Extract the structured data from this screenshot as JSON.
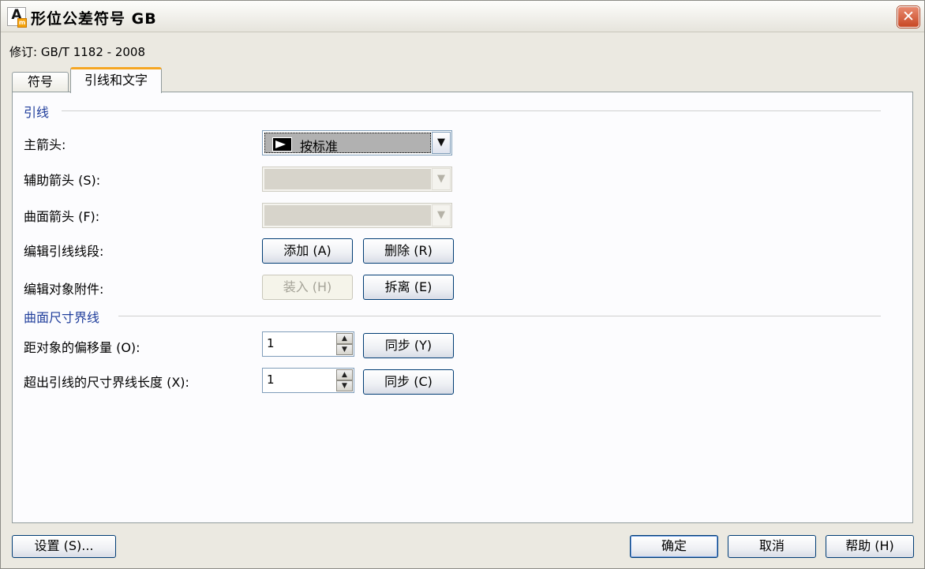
{
  "window": {
    "title": "形位公差符号 GB",
    "app_icon_letter": "A",
    "app_icon_sub": "m",
    "close_glyph": "✕"
  },
  "revision": "修订: GB/T 1182 - 2008",
  "tabs": [
    {
      "label": "符号",
      "active": false
    },
    {
      "label": "引线和文字",
      "active": true
    }
  ],
  "leader_section": {
    "title": "引线",
    "main_arrow": {
      "label": "主箭头:",
      "value": "按标准",
      "arrow_glyph": "▼"
    },
    "aux_arrow": {
      "label": "辅助箭头 (S):",
      "value": "",
      "arrow_glyph": "▼"
    },
    "surface_arrow": {
      "label": "曲面箭头 (F):",
      "value": "",
      "arrow_glyph": "▼"
    },
    "edit_segments": {
      "label": "编辑引线线段:",
      "add_label": "添加 (A)",
      "delete_label": "删除 (R)"
    },
    "edit_attach": {
      "label": "编辑对象附件:",
      "load_label": "装入 (H)",
      "detach_label": "拆离 (E)"
    }
  },
  "ext_section": {
    "title": "曲面尺寸界线",
    "offset": {
      "label": "距对象的偏移量 (O):",
      "value": "1",
      "sync_label": "同步 (Y)"
    },
    "extend": {
      "label": "超出引线的尺寸界线长度 (X):",
      "value": "1",
      "sync_label": "同步 (C)"
    }
  },
  "spin_glyphs": {
    "up": "▲",
    "down": "▼"
  },
  "footer": {
    "settings_label": "设置 (S)...",
    "ok_label": "确定",
    "cancel_label": "取消",
    "help_label": "帮助 (H)"
  }
}
